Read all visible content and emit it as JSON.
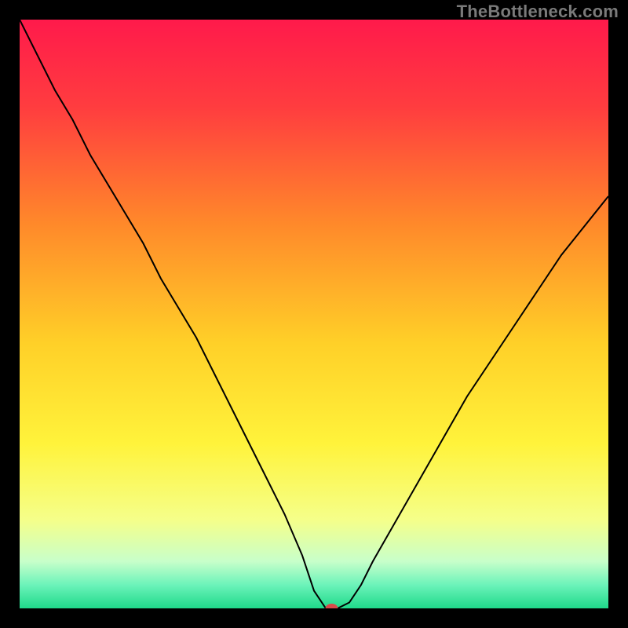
{
  "watermark": "TheBottleneck.com",
  "chart_data": {
    "type": "line",
    "title": "",
    "xlabel": "",
    "ylabel": "",
    "xlim": [
      0,
      100
    ],
    "ylim": [
      0,
      100
    ],
    "grid": false,
    "background_gradient": {
      "stops": [
        {
          "offset": 0.0,
          "color": "#ff1a4b"
        },
        {
          "offset": 0.15,
          "color": "#ff3d3f"
        },
        {
          "offset": 0.35,
          "color": "#ff8a2a"
        },
        {
          "offset": 0.55,
          "color": "#ffd028"
        },
        {
          "offset": 0.72,
          "color": "#fff33b"
        },
        {
          "offset": 0.85,
          "color": "#f5ff8a"
        },
        {
          "offset": 0.92,
          "color": "#c8ffca"
        },
        {
          "offset": 0.96,
          "color": "#6cf3ba"
        },
        {
          "offset": 1.0,
          "color": "#1fd98a"
        }
      ]
    },
    "series": [
      {
        "name": "bottleneck-curve",
        "color": "#000000",
        "stroke_width": 2.0,
        "x": [
          0,
          3,
          6,
          9,
          12,
          15,
          18,
          21,
          24,
          27,
          30,
          33,
          36,
          39,
          42,
          45,
          48,
          50,
          52,
          54,
          56,
          58,
          60,
          64,
          68,
          72,
          76,
          80,
          84,
          88,
          92,
          96,
          100
        ],
        "y": [
          100,
          94,
          88,
          83,
          77,
          72,
          67,
          62,
          56,
          51,
          46,
          40,
          34,
          28,
          22,
          16,
          9,
          3,
          0,
          0,
          1,
          4,
          8,
          15,
          22,
          29,
          36,
          42,
          48,
          54,
          60,
          65,
          70
        ]
      }
    ],
    "marker": {
      "name": "minimum-marker",
      "x": 53,
      "y": 0,
      "color": "#d94a4a",
      "rx": 8,
      "ry": 6
    }
  }
}
